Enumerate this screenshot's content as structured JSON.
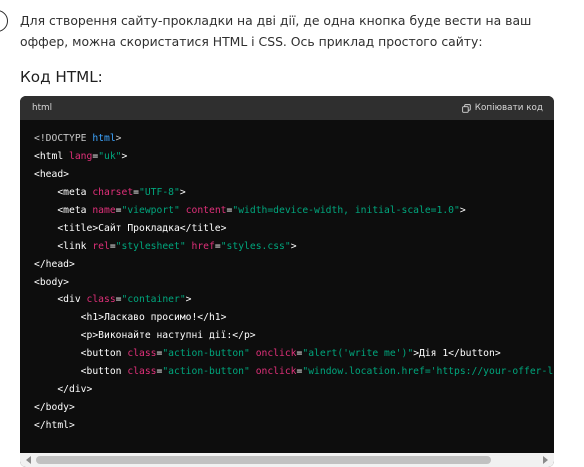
{
  "message": {
    "intro": "Для створення сайту-прокладки на дві дії, де одна кнопка буде вести на ваш оффер, можна скористатися HTML і CSS. Ось приклад простого сайту:",
    "heading": "Код HTML:"
  },
  "code_block": {
    "language": "html",
    "copy_label": "Копіювати код",
    "lines": [
      [
        {
          "t": "<!DOCTYPE ",
          "c": "doc"
        },
        {
          "t": "html",
          "c": "kw"
        },
        {
          "t": ">",
          "c": "doc"
        }
      ],
      [
        {
          "t": "<html ",
          "c": "tag"
        },
        {
          "t": "lang",
          "c": "attr"
        },
        {
          "t": "=",
          "c": "tag"
        },
        {
          "t": "\"uk\"",
          "c": "str"
        },
        {
          "t": ">",
          "c": "tag"
        }
      ],
      [
        {
          "t": "<head>",
          "c": "tag"
        }
      ],
      [
        {
          "t": "    <meta ",
          "c": "tag"
        },
        {
          "t": "charset",
          "c": "attr"
        },
        {
          "t": "=",
          "c": "tag"
        },
        {
          "t": "\"UTF-8\"",
          "c": "str"
        },
        {
          "t": ">",
          "c": "tag"
        }
      ],
      [
        {
          "t": "    <meta ",
          "c": "tag"
        },
        {
          "t": "name",
          "c": "attr"
        },
        {
          "t": "=",
          "c": "tag"
        },
        {
          "t": "\"viewport\"",
          "c": "str"
        },
        {
          "t": " ",
          "c": "tag"
        },
        {
          "t": "content",
          "c": "attr"
        },
        {
          "t": "=",
          "c": "tag"
        },
        {
          "t": "\"width=device-width, initial-scale=1.0\"",
          "c": "str"
        },
        {
          "t": ">",
          "c": "tag"
        }
      ],
      [
        {
          "t": "    <title>Сайт Прокладка</title>",
          "c": "tag"
        }
      ],
      [
        {
          "t": "    <link ",
          "c": "tag"
        },
        {
          "t": "rel",
          "c": "attr"
        },
        {
          "t": "=",
          "c": "tag"
        },
        {
          "t": "\"stylesheet\"",
          "c": "str"
        },
        {
          "t": " ",
          "c": "tag"
        },
        {
          "t": "href",
          "c": "attr"
        },
        {
          "t": "=",
          "c": "tag"
        },
        {
          "t": "\"styles.css\"",
          "c": "str"
        },
        {
          "t": ">",
          "c": "tag"
        }
      ],
      [
        {
          "t": "</head>",
          "c": "tag"
        }
      ],
      [
        {
          "t": "<body>",
          "c": "tag"
        }
      ],
      [
        {
          "t": "    <div ",
          "c": "tag"
        },
        {
          "t": "class",
          "c": "attr"
        },
        {
          "t": "=",
          "c": "tag"
        },
        {
          "t": "\"container\"",
          "c": "str"
        },
        {
          "t": ">",
          "c": "tag"
        }
      ],
      [
        {
          "t": "        <h1>Ласкаво просимо!</h1>",
          "c": "tag"
        }
      ],
      [
        {
          "t": "        <p>Виконайте наступні дії:</p>",
          "c": "tag"
        }
      ],
      [
        {
          "t": "        <button ",
          "c": "tag"
        },
        {
          "t": "class",
          "c": "attr"
        },
        {
          "t": "=",
          "c": "tag"
        },
        {
          "t": "\"action-button\"",
          "c": "str"
        },
        {
          "t": " ",
          "c": "tag"
        },
        {
          "t": "onclick",
          "c": "attr"
        },
        {
          "t": "=",
          "c": "tag"
        },
        {
          "t": "\"alert('write me')\"",
          "c": "str"
        },
        {
          "t": ">Дія 1</button>",
          "c": "tag"
        }
      ],
      [
        {
          "t": "        <button ",
          "c": "tag"
        },
        {
          "t": "class",
          "c": "attr"
        },
        {
          "t": "=",
          "c": "tag"
        },
        {
          "t": "\"action-button\"",
          "c": "str"
        },
        {
          "t": " ",
          "c": "tag"
        },
        {
          "t": "onclick",
          "c": "attr"
        },
        {
          "t": "=",
          "c": "tag"
        },
        {
          "t": "\"window.location.href='https://your-offer-li",
          "c": "str"
        }
      ],
      [
        {
          "t": "    </div>",
          "c": "tag"
        }
      ],
      [
        {
          "t": "</body>",
          "c": "tag"
        }
      ],
      [
        {
          "t": "</html>",
          "c": "tag"
        }
      ]
    ]
  },
  "colors": {
    "code_background": "#0d0d0d",
    "header_background": "#2f2f2f",
    "keyword": "#3ea5ff",
    "attribute": "#df3079",
    "string": "#00a67d"
  },
  "icons": {
    "copy": "copy-icon",
    "scroll_left": "scroll-left-icon",
    "scroll_right": "scroll-right-icon"
  }
}
